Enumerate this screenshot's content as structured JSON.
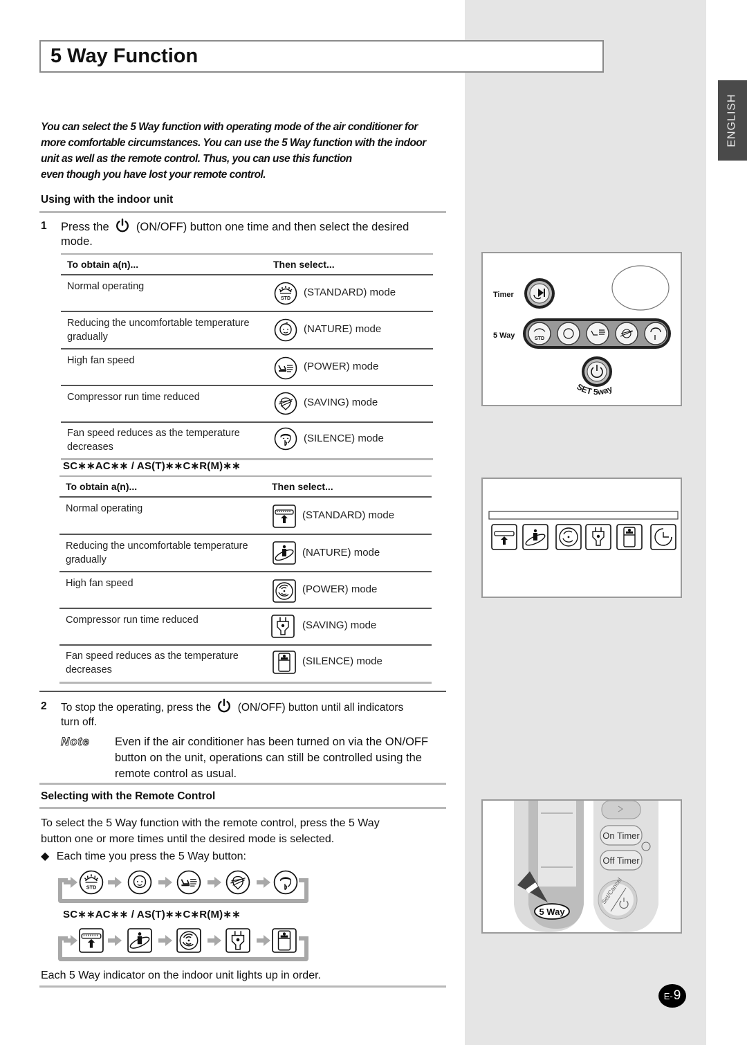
{
  "page": {
    "title": "5 Way Function",
    "language_tab": "ENGLISH",
    "page_number_prefix": "E-",
    "page_number": "9"
  },
  "intro": {
    "lines": [
      "You can select the 5 Way function with operating mode of the air conditioner for",
      "more comfortable circumstances. You can use the 5 Way function with the indoor",
      "unit as well as the remote control. Thus, you can use this function",
      "even though you have lost your remote control."
    ]
  },
  "indoor": {
    "heading": "Using with the indoor unit",
    "step1": {
      "num": "1",
      "before": "Press the",
      "after": "(ON/OFF) button one time and then select the desired",
      "line2": "mode."
    },
    "table_headers": {
      "col1": "To obtain a(n)...",
      "col2": "Then select..."
    },
    "table1": [
      {
        "desc": "Normal operating",
        "mode": "(STANDARD) mode",
        "icon": "standard-round-icon"
      },
      {
        "desc": "Reducing the uncomfortable temperature gradually",
        "mode": "(NATURE) mode",
        "icon": "nature-round-icon"
      },
      {
        "desc": "High fan speed",
        "mode": "(POWER) mode",
        "icon": "power-round-icon"
      },
      {
        "desc": "Compressor run time reduced",
        "mode": "(SAVING) mode",
        "icon": "saving-round-icon"
      },
      {
        "desc": "Fan speed reduces as the temperature decreases",
        "mode": "(SILENCE) mode",
        "icon": "silence-round-icon"
      }
    ],
    "model_label": "SC∗∗AC∗∗ / AS(T)∗∗C∗R(M)∗∗",
    "table2": [
      {
        "desc": "Normal operating",
        "mode": "(STANDARD) mode",
        "icon": "standard-square-icon"
      },
      {
        "desc": "Reducing the uncomfortable temperature gradually",
        "mode": "(NATURE) mode",
        "icon": "nature-square-icon"
      },
      {
        "desc": "High fan speed",
        "mode": "(POWER) mode",
        "icon": "power-square-icon"
      },
      {
        "desc": "Compressor run time reduced",
        "mode": "(SAVING) mode",
        "icon": "saving-square-icon"
      },
      {
        "desc": "Fan speed reduces as the temperature decreases",
        "mode": "(SILENCE) mode",
        "icon": "silence-square-icon"
      }
    ],
    "step2": {
      "num": "2",
      "before": "To stop the operating, press the",
      "after": "(ON/OFF) button until all indicators",
      "line2": "turn off."
    },
    "note": {
      "label": "Note",
      "text": "Even if the air conditioner has been turned on via the ON/OFF button on the unit, operations can still be controlled using the remote control as usual."
    }
  },
  "remote": {
    "heading": "Selecting with the Remote Control",
    "line1": "To select the 5 Way function with the remote control, press the 5 Way",
    "line2": "button one or more times until the desired mode is selected.",
    "bullet_symbol": "◆",
    "bullet_text": "Each time you press the 5 Way button:",
    "model_label": "SC∗∗AC∗∗ / AS(T)∗∗C∗R(M)∗∗",
    "footer": "Each 5 Way indicator on the indoor unit lights up in order."
  },
  "illustrations": {
    "unit_panel": {
      "timer_label": "Timer",
      "five_way_label": "5 Way",
      "std_label": "STD",
      "set_label": "SET 5way"
    },
    "remote_panel": {
      "on_timer": "On Timer",
      "off_timer": "Off Timer",
      "set_cancel": "Set/Cancel",
      "five_way": "5 Way"
    }
  }
}
